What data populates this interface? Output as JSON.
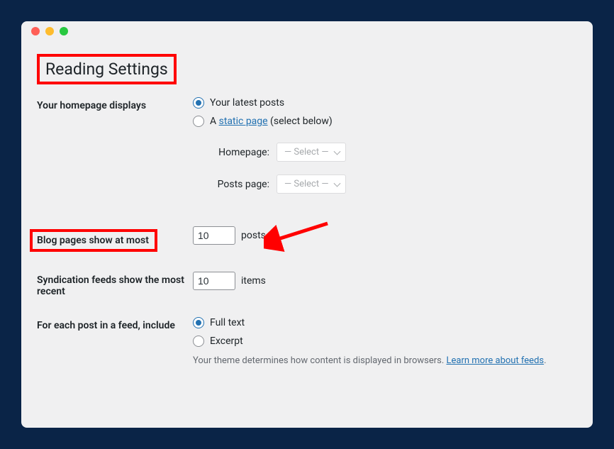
{
  "page": {
    "title": "Reading Settings"
  },
  "homepage": {
    "label": "Your homepage displays",
    "options": {
      "latest": "Your latest posts",
      "static_prefix": "A ",
      "static_link": "static page",
      "static_suffix": " (select below)"
    },
    "selected": "latest",
    "selects": {
      "homepage_label": "Homepage:",
      "homepage_value": "— Select —",
      "posts_label": "Posts page:",
      "posts_value": "— Select —"
    }
  },
  "blog_pages": {
    "label": "Blog pages show at most",
    "value": "10",
    "suffix": "posts"
  },
  "syndication": {
    "label": "Syndication feeds show the most recent",
    "value": "10",
    "suffix": "items"
  },
  "feed_content": {
    "label": "For each post in a feed, include",
    "options": {
      "full": "Full text",
      "excerpt": "Excerpt"
    },
    "selected": "full",
    "description_prefix": "Your theme determines how content is displayed in browsers. ",
    "description_link": "Learn more about feeds",
    "description_suffix": "."
  }
}
